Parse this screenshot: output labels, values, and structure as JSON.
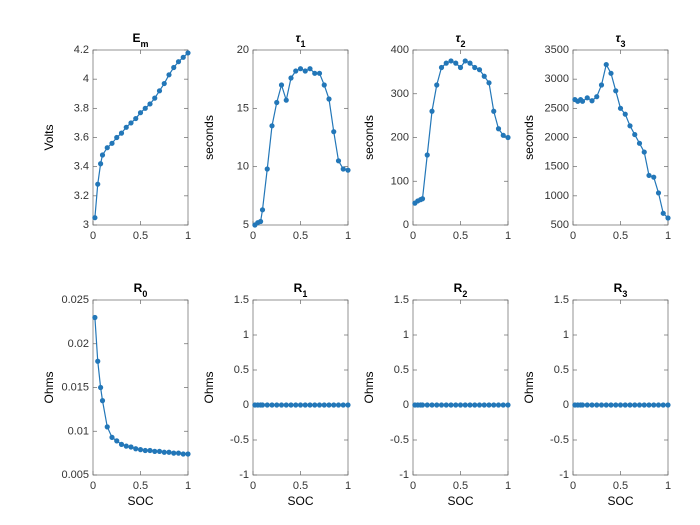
{
  "chart_data": [
    {
      "type": "line",
      "title": "E_m",
      "title_display": "E",
      "title_sub": "m",
      "ylabel": "Volts",
      "xlabel": "",
      "xlim": [
        0,
        1
      ],
      "ylim": [
        3,
        4.2
      ],
      "xticks": [
        0,
        0.5,
        1
      ],
      "yticks": [
        3,
        3.2,
        3.4,
        3.6,
        3.8,
        4,
        4.2
      ],
      "x": [
        0.02,
        0.05,
        0.08,
        0.1,
        0.15,
        0.2,
        0.25,
        0.3,
        0.35,
        0.4,
        0.45,
        0.5,
        0.55,
        0.6,
        0.65,
        0.7,
        0.75,
        0.8,
        0.85,
        0.9,
        0.95,
        1.0
      ],
      "y": [
        3.05,
        3.28,
        3.42,
        3.48,
        3.53,
        3.56,
        3.6,
        3.63,
        3.67,
        3.7,
        3.73,
        3.77,
        3.8,
        3.83,
        3.87,
        3.92,
        3.97,
        4.03,
        4.08,
        4.12,
        4.15,
        4.18
      ]
    },
    {
      "type": "line",
      "title": "τ_1",
      "title_display": "τ",
      "title_sub": "1",
      "ylabel": "seconds",
      "xlabel": "",
      "xlim": [
        0,
        1
      ],
      "ylim": [
        5,
        20
      ],
      "xticks": [
        0,
        0.5,
        1
      ],
      "yticks": [
        5,
        10,
        15,
        20
      ],
      "x": [
        0.02,
        0.05,
        0.08,
        0.1,
        0.15,
        0.2,
        0.25,
        0.3,
        0.35,
        0.4,
        0.45,
        0.5,
        0.55,
        0.6,
        0.65,
        0.7,
        0.75,
        0.8,
        0.85,
        0.9,
        0.95,
        1.0
      ],
      "y": [
        5.0,
        5.2,
        5.3,
        6.3,
        9.8,
        13.5,
        15.5,
        17.0,
        15.7,
        17.6,
        18.2,
        18.4,
        18.2,
        18.4,
        18.0,
        18.0,
        17.0,
        15.8,
        13.0,
        10.5,
        9.8,
        9.7
      ]
    },
    {
      "type": "line",
      "title": "τ_2",
      "title_display": "τ",
      "title_sub": "2",
      "ylabel": "seconds",
      "xlabel": "",
      "xlim": [
        0,
        1
      ],
      "ylim": [
        0,
        400
      ],
      "xticks": [
        0,
        0.5,
        1
      ],
      "yticks": [
        0,
        100,
        200,
        300,
        400
      ],
      "x": [
        0.02,
        0.05,
        0.08,
        0.1,
        0.15,
        0.2,
        0.25,
        0.3,
        0.35,
        0.4,
        0.45,
        0.5,
        0.55,
        0.6,
        0.65,
        0.7,
        0.75,
        0.8,
        0.85,
        0.9,
        0.95,
        1.0
      ],
      "y": [
        50,
        55,
        58,
        60,
        160,
        260,
        320,
        360,
        370,
        375,
        370,
        360,
        375,
        370,
        360,
        355,
        340,
        325,
        260,
        220,
        205,
        200
      ]
    },
    {
      "type": "line",
      "title": "τ_3",
      "title_display": "τ",
      "title_sub": "3",
      "ylabel": "seconds",
      "xlabel": "",
      "xlim": [
        0,
        1
      ],
      "ylim": [
        500,
        3500
      ],
      "xticks": [
        0,
        0.5,
        1
      ],
      "yticks": [
        500,
        1000,
        1500,
        2000,
        2500,
        3000,
        3500
      ],
      "x": [
        0.02,
        0.05,
        0.08,
        0.1,
        0.15,
        0.2,
        0.25,
        0.3,
        0.35,
        0.4,
        0.45,
        0.5,
        0.55,
        0.6,
        0.65,
        0.7,
        0.75,
        0.8,
        0.85,
        0.9,
        0.95,
        1.0
      ],
      "y": [
        2650,
        2620,
        2650,
        2620,
        2680,
        2630,
        2700,
        2900,
        3250,
        3100,
        2800,
        2500,
        2400,
        2200,
        2050,
        1900,
        1750,
        1350,
        1320,
        1050,
        700,
        620
      ]
    },
    {
      "type": "line",
      "title": "R_0",
      "title_display": "R",
      "title_sub": "0",
      "ylabel": "Ohms",
      "xlabel": "SOC",
      "xlim": [
        0,
        1
      ],
      "ylim": [
        0.005,
        0.025
      ],
      "xticks": [
        0,
        0.5,
        1
      ],
      "yticks": [
        0.005,
        0.01,
        0.015,
        0.02,
        0.025
      ],
      "x": [
        0.02,
        0.05,
        0.08,
        0.1,
        0.15,
        0.2,
        0.25,
        0.3,
        0.35,
        0.4,
        0.45,
        0.5,
        0.55,
        0.6,
        0.65,
        0.7,
        0.75,
        0.8,
        0.85,
        0.9,
        0.95,
        1.0
      ],
      "y": [
        0.023,
        0.018,
        0.015,
        0.0135,
        0.0105,
        0.0093,
        0.0089,
        0.0085,
        0.0083,
        0.0082,
        0.008,
        0.0079,
        0.0078,
        0.0078,
        0.0077,
        0.0077,
        0.0076,
        0.0076,
        0.0075,
        0.0075,
        0.0074,
        0.0074
      ]
    },
    {
      "type": "line",
      "title": "R_1",
      "title_display": "R",
      "title_sub": "1",
      "ylabel": "Ohms",
      "xlabel": "SOC",
      "xlim": [
        0,
        1
      ],
      "ylim": [
        -1,
        1.5
      ],
      "xticks": [
        0,
        0.5,
        1
      ],
      "yticks": [
        -1,
        -0.5,
        0,
        0.5,
        1,
        1.5
      ],
      "x": [
        0.02,
        0.05,
        0.08,
        0.1,
        0.15,
        0.2,
        0.25,
        0.3,
        0.35,
        0.4,
        0.45,
        0.5,
        0.55,
        0.6,
        0.65,
        0.7,
        0.75,
        0.8,
        0.85,
        0.9,
        0.95,
        1.0
      ],
      "y": [
        0,
        0,
        0,
        0,
        0,
        0,
        0,
        0,
        0,
        0,
        0,
        0,
        0,
        0,
        0,
        0,
        0,
        0,
        0,
        0,
        0,
        0
      ]
    },
    {
      "type": "line",
      "title": "R_2",
      "title_display": "R",
      "title_sub": "2",
      "ylabel": "Ohms",
      "xlabel": "SOC",
      "xlim": [
        0,
        1
      ],
      "ylim": [
        -1,
        1.5
      ],
      "xticks": [
        0,
        0.5,
        1
      ],
      "yticks": [
        -1,
        -0.5,
        0,
        0.5,
        1,
        1.5
      ],
      "x": [
        0.02,
        0.05,
        0.08,
        0.1,
        0.15,
        0.2,
        0.25,
        0.3,
        0.35,
        0.4,
        0.45,
        0.5,
        0.55,
        0.6,
        0.65,
        0.7,
        0.75,
        0.8,
        0.85,
        0.9,
        0.95,
        1.0
      ],
      "y": [
        0,
        0,
        0,
        0,
        0,
        0,
        0,
        0,
        0,
        0,
        0,
        0,
        0,
        0,
        0,
        0,
        0,
        0,
        0,
        0,
        0,
        0
      ]
    },
    {
      "type": "line",
      "title": "R_3",
      "title_display": "R",
      "title_sub": "3",
      "ylabel": "Ohms",
      "xlabel": "SOC",
      "xlim": [
        0,
        1
      ],
      "ylim": [
        -1,
        1.5
      ],
      "xticks": [
        0,
        0.5,
        1
      ],
      "yticks": [
        -1,
        -0.5,
        0,
        0.5,
        1,
        1.5
      ],
      "x": [
        0.02,
        0.05,
        0.08,
        0.1,
        0.15,
        0.2,
        0.25,
        0.3,
        0.35,
        0.4,
        0.45,
        0.5,
        0.55,
        0.6,
        0.65,
        0.7,
        0.75,
        0.8,
        0.85,
        0.9,
        0.95,
        1.0
      ],
      "y": [
        0,
        0,
        0,
        0,
        0,
        0,
        0,
        0,
        0,
        0,
        0,
        0,
        0,
        0,
        0,
        0,
        0,
        0,
        0,
        0,
        0,
        0
      ]
    }
  ],
  "layout": {
    "cols": 4,
    "rows": 2,
    "fig_w": 700,
    "fig_h": 525,
    "panel_left_margin": 58,
    "panel_top_margin": 30,
    "panel_w_axis": 95,
    "panel_h_axis": 175,
    "col_gap": 60,
    "row_gap": 60
  }
}
